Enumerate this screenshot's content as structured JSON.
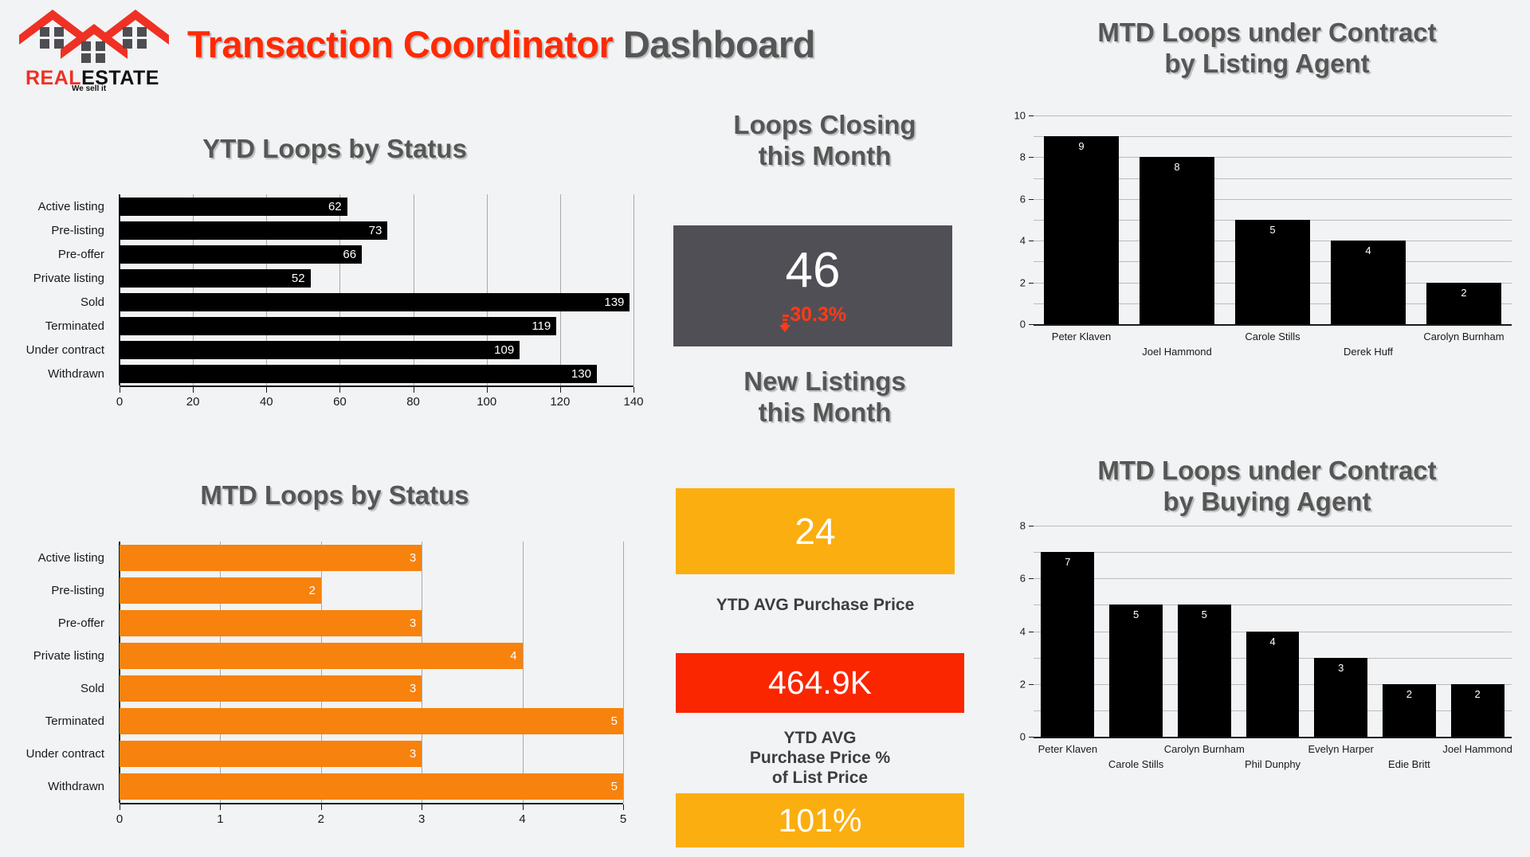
{
  "brand": {
    "logo_text_part1": "REAL",
    "logo_text_part2": "ESTATE",
    "logo_tagline": "We sell it",
    "logo_icon": "three-houses-icon",
    "accent_red": "#EE3124"
  },
  "header": {
    "title_accent": "Transaction Coordinator",
    "title_rest": " Dashboard",
    "accent_color": "#FF2A00",
    "text_color": "#565656"
  },
  "panels": {
    "ytd_loops_title": "YTD Loops by Status",
    "mtd_loops_title": "MTD Loops by Status",
    "loops_closing_title_line1": "Loops Closing",
    "loops_closing_title_line2": "this Month",
    "new_listings_title_line1": "New Listings",
    "new_listings_title_line2": "this Month",
    "listing_agent_title_line1": "MTD Loops under Contract",
    "listing_agent_title_line2": "by Listing Agent",
    "buying_agent_title_line1": "MTD Loops under Contract",
    "buying_agent_title_line2": "by Buying Agent"
  },
  "kpis": {
    "loops_closing": {
      "value": "46",
      "delta": "-30.3%",
      "delta_direction": "down",
      "delta_icon": "arrow-down-icon",
      "box_color": "#514F56",
      "delta_color": "#FF3B18"
    },
    "new_listings": {
      "value": "24",
      "box_color": "#FBAE10"
    },
    "ytd_avg_purchase_price": {
      "caption": "YTD AVG Purchase Price",
      "value": "464.9K",
      "box_color": "#FA2600"
    },
    "ytd_avg_pct_of_list": {
      "caption_line1": "YTD AVG",
      "caption_line2": "Purchase Price %",
      "caption_line3": "of List Price",
      "value": "101%",
      "box_color": "#FBAE10"
    }
  },
  "chart_data": [
    {
      "id": "ytd_loops_by_status",
      "type": "bar",
      "orientation": "horizontal",
      "title": "YTD Loops by Status",
      "categories": [
        "Active listing",
        "Pre-listing",
        "Pre-offer",
        "Private listing",
        "Sold",
        "Terminated",
        "Under contract",
        "Withdrawn"
      ],
      "values": [
        62,
        73,
        66,
        52,
        139,
        119,
        109,
        130
      ],
      "xlabel": "",
      "ylabel": "",
      "xlim": [
        0,
        140
      ],
      "xticks": [
        0,
        20,
        40,
        60,
        80,
        100,
        120,
        140
      ],
      "bar_color": "#000000",
      "grid": true,
      "legend": "none"
    },
    {
      "id": "mtd_loops_by_status",
      "type": "bar",
      "orientation": "horizontal",
      "title": "MTD Loops by Status",
      "categories": [
        "Active listing",
        "Pre-listing",
        "Pre-offer",
        "Private listing",
        "Sold",
        "Terminated",
        "Under contract",
        "Withdrawn"
      ],
      "values": [
        3,
        2,
        3,
        4,
        3,
        5,
        3,
        5
      ],
      "xlabel": "",
      "ylabel": "",
      "xlim": [
        0,
        5
      ],
      "xticks": [
        0,
        1,
        2,
        3,
        4,
        5
      ],
      "bar_color": "#F7820D",
      "grid": true,
      "legend": "none"
    },
    {
      "id": "mtd_loops_under_contract_by_listing_agent",
      "type": "bar",
      "orientation": "vertical",
      "title": "MTD Loops under Contract by Listing Agent",
      "categories": [
        "Peter Klaven",
        "Joel Hammond",
        "Carole Stills",
        "Derek Huff",
        "Carolyn Burnham"
      ],
      "values": [
        9,
        8,
        5,
        4,
        2
      ],
      "xlabel": "",
      "ylabel": "",
      "ylim": [
        0,
        10
      ],
      "yticks": [
        0,
        2,
        4,
        6,
        8,
        10
      ],
      "gridline_step": 1,
      "bar_color": "#000000",
      "grid": true,
      "legend": "none"
    },
    {
      "id": "mtd_loops_under_contract_by_buying_agent",
      "type": "bar",
      "orientation": "vertical",
      "title": "MTD Loops under Contract by Buying Agent",
      "categories": [
        "Peter Klaven",
        "Carole Stills",
        "Carolyn Burnham",
        "Phil Dunphy",
        "Evelyn Harper",
        "Edie Britt",
        "Joel Hammond"
      ],
      "values": [
        7,
        5,
        5,
        4,
        3,
        2,
        2
      ],
      "xlabel": "",
      "ylabel": "",
      "ylim": [
        0,
        8
      ],
      "yticks": [
        0,
        2,
        4,
        6,
        8
      ],
      "gridline_step": 1,
      "bar_color": "#000000",
      "grid": true,
      "legend": "none"
    }
  ]
}
